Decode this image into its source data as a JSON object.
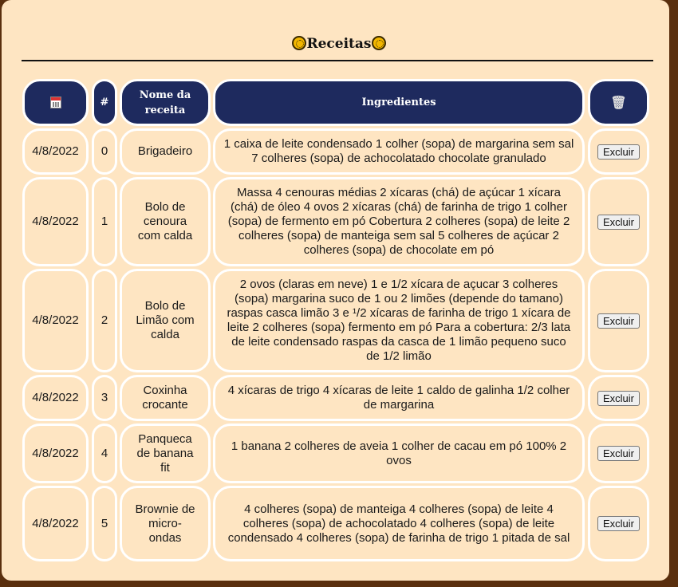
{
  "page": {
    "title": "Receitas"
  },
  "table": {
    "headers": {
      "date_icon": "calendar-icon",
      "index": "#",
      "name": "Nome da receita",
      "ingredients": "Ingredientes",
      "delete_icon": "trash-icon"
    },
    "delete_label": "Excluir",
    "rows": [
      {
        "date": "4/8/2022",
        "id": "0",
        "name": "Brigadeiro",
        "ingredients": "1 caixa de leite condensado 1 colher (sopa) de margarina sem sal 7 colheres (sopa) de achocolatado chocolate granulado"
      },
      {
        "date": "4/8/2022",
        "id": "1",
        "name": "Bolo de cenoura com calda",
        "ingredients": "Massa 4 cenouras médias 2 xícaras (chá) de açúcar 1 xícara (chá) de óleo 4 ovos 2 xícaras (chá) de farinha de trigo 1 colher (sopa) de fermento em pó Cobertura 2 colheres (sopa) de leite 2 colheres (sopa) de manteiga sem sal 5 colheres de açúcar 2 colheres (sopa) de chocolate em pó"
      },
      {
        "date": "4/8/2022",
        "id": "2",
        "name": "Bolo de Limão com calda",
        "ingredients": "2 ovos (claras em neve) 1 e 1/2 xícara de açucar 3 colheres (sopa) margarina suco de 1 ou 2 limões (depende do tamano) raspas casca limão 3 e ¹/2 xícaras de farinha de trigo 1 xícara de leite 2 colheres (sopa) fermento em pó Para a cobertura: 2/3 lata de leite condensado raspas da casca de 1 limão pequeno suco de 1/2 limão"
      },
      {
        "date": "4/8/2022",
        "id": "3",
        "name": "Coxinha crocante",
        "ingredients": "4 xícaras de trigo 4 xícaras de leite 1 caldo de galinha 1/2 colher de margarina"
      },
      {
        "date": "4/8/2022",
        "id": "4",
        "name": "Panqueca de banana fit",
        "ingredients": "1 banana 2 colheres de aveia 1 colher de cacau em pó 100% 2 ovos"
      },
      {
        "date": "4/8/2022",
        "id": "5",
        "name": "Brownie de micro-ondas",
        "ingredients": "4 colheres (sopa) de manteiga 4 colheres (sopa) de leite 4 colheres (sopa) de achocolatado 4 colheres (sopa) de leite condensado 4 colheres (sopa) de farinha de trigo 1 pitada de sal"
      }
    ]
  }
}
